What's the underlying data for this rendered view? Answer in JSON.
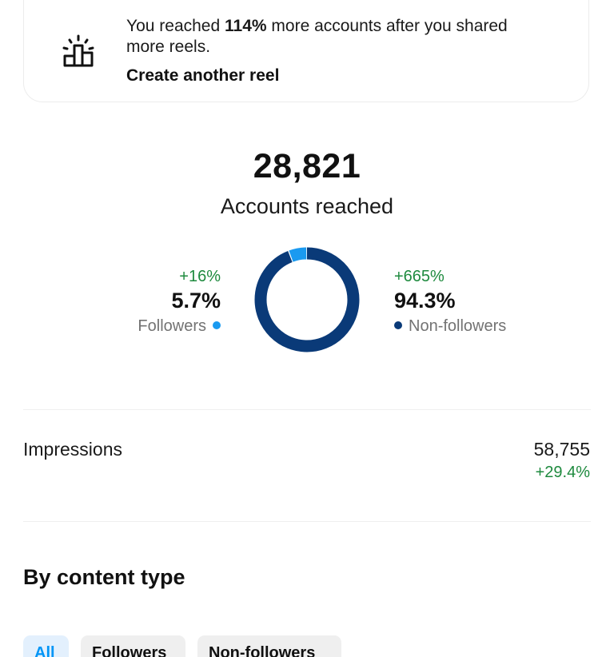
{
  "promo": {
    "text_before": "You reached ",
    "text_bold": "114%",
    "text_after": " more accounts after you shared more reels.",
    "link_label": "Create another reel",
    "icon": "podium-sparkle-icon"
  },
  "reach": {
    "total": "28,821",
    "label": "Accounts reached"
  },
  "audience": {
    "followers": {
      "change": "+16%",
      "percent": "5.7%",
      "label": "Followers",
      "color": "#1a9af0"
    },
    "non_followers": {
      "change": "+665%",
      "percent": "94.3%",
      "label": "Non-followers",
      "color": "#0a3a78"
    }
  },
  "chart_data": {
    "type": "pie",
    "categories": [
      "Followers",
      "Non-followers"
    ],
    "values": [
      5.7,
      94.3
    ],
    "colors": [
      "#1a9af0",
      "#0a3a78"
    ],
    "donut": true
  },
  "impressions": {
    "label": "Impressions",
    "value": "58,755",
    "change": "+29.4%"
  },
  "content_type": {
    "title": "By content type",
    "filters": [
      {
        "label": "All",
        "active": true
      },
      {
        "label": "Followers",
        "active": false
      },
      {
        "label": "Non-followers",
        "active": false
      }
    ]
  },
  "colors": {
    "positive": "#1e8a3e",
    "accent": "#0095f6",
    "muted_text": "#737373"
  }
}
